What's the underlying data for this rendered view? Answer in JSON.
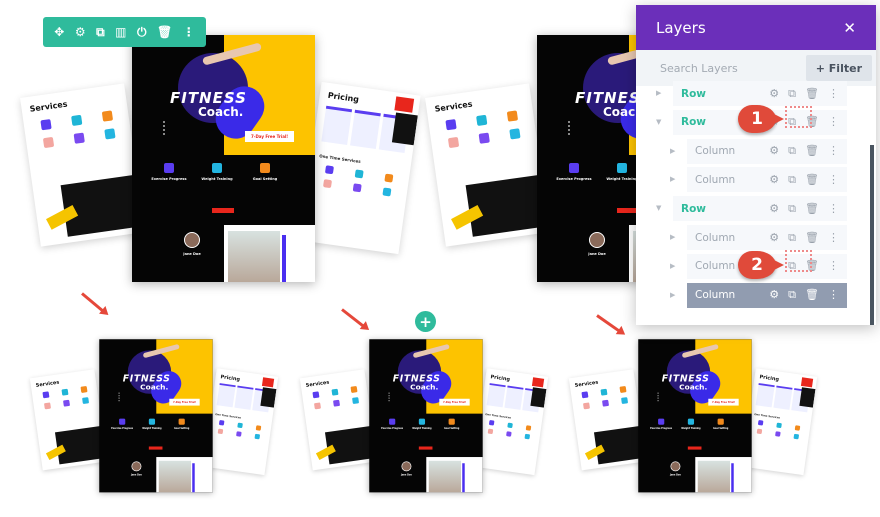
{
  "toolbar": {
    "icons": [
      "move-icon",
      "gear-icon",
      "duplicate-icon",
      "columns-icon",
      "power-icon",
      "trash-icon",
      "more-icon"
    ],
    "glyphs": [
      "✥",
      "⚙",
      "⧉",
      "▥",
      "⏻",
      "🗑",
      "⋮"
    ],
    "color": "#2fbb9c"
  },
  "layout": {
    "services_title": "Services",
    "pricing_title": "Pricing",
    "hero_title": "FITNESS",
    "hero_subtitle": "Coach.",
    "cta": "7-Day Free Trial!",
    "features": [
      "Exercise Progress",
      "Weight Training",
      "Goal Setting"
    ],
    "person_name": "Jane Doe",
    "services_label": "One Time Services"
  },
  "layers": {
    "title": "Layers",
    "close": "✕",
    "search_placeholder": "Search Layers",
    "filter_label": "+ Filter",
    "header_color": "#6b2fba",
    "items": [
      {
        "label": "Row",
        "type": "row",
        "expanded": false
      },
      {
        "label": "Row",
        "type": "row",
        "expanded": true
      },
      {
        "label": "Column",
        "type": "col"
      },
      {
        "label": "Column",
        "type": "col"
      },
      {
        "label": "Row",
        "type": "row",
        "expanded": true
      },
      {
        "label": "Column",
        "type": "col"
      },
      {
        "label": "Column",
        "type": "col"
      },
      {
        "label": "Column",
        "type": "col",
        "selected": true
      }
    ]
  },
  "annotations": {
    "badge1": "1",
    "badge2": "2",
    "color": "#e04a3a"
  },
  "add_button": "+"
}
